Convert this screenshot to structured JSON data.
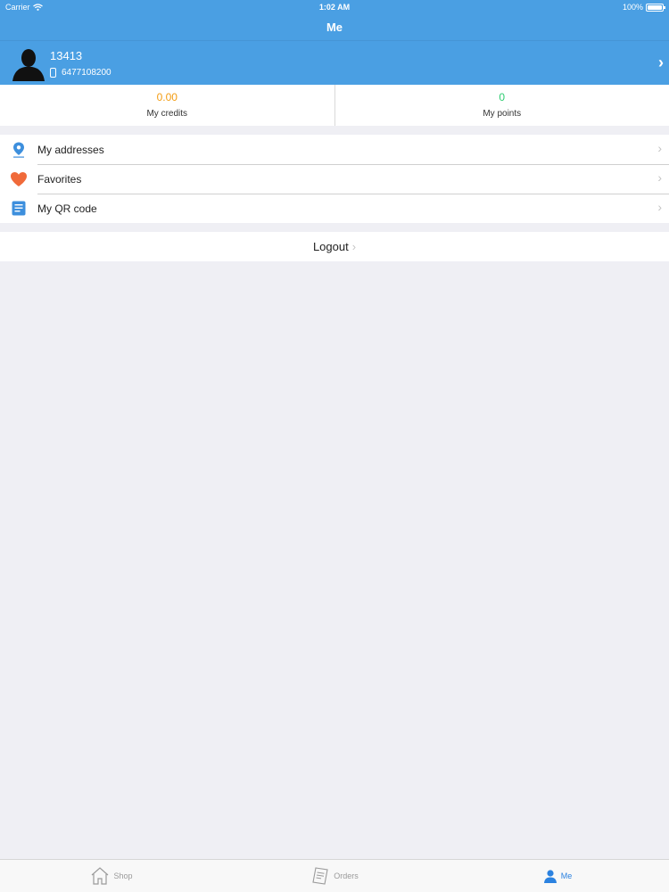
{
  "status_bar": {
    "carrier": "Carrier",
    "time": "1:02 AM",
    "battery": "100%",
    "battery_level": 1.0
  },
  "nav": {
    "title": "Me"
  },
  "profile": {
    "name": "13413",
    "phone": "6477108200"
  },
  "stats": {
    "credits": {
      "value": "0.00",
      "label": "My credits",
      "color": "#f39c12"
    },
    "points": {
      "value": "0",
      "label": "My points",
      "color": "#2ecc71"
    }
  },
  "menu": [
    {
      "label": "My addresses",
      "icon": "location-pin-icon"
    },
    {
      "label": "Favorites",
      "icon": "heart-icon"
    },
    {
      "label": "My QR code",
      "icon": "document-icon"
    }
  ],
  "logout": {
    "label": "Logout"
  },
  "tabs": [
    {
      "label": "Shop",
      "icon": "home-icon"
    },
    {
      "label": "Orders",
      "icon": "receipt-icon"
    },
    {
      "label": "Me",
      "icon": "person-icon",
      "active": true
    }
  ],
  "colors": {
    "accent": "#4a9fe3",
    "active_tab": "#2b82e0",
    "heart": "#f06a3a"
  }
}
